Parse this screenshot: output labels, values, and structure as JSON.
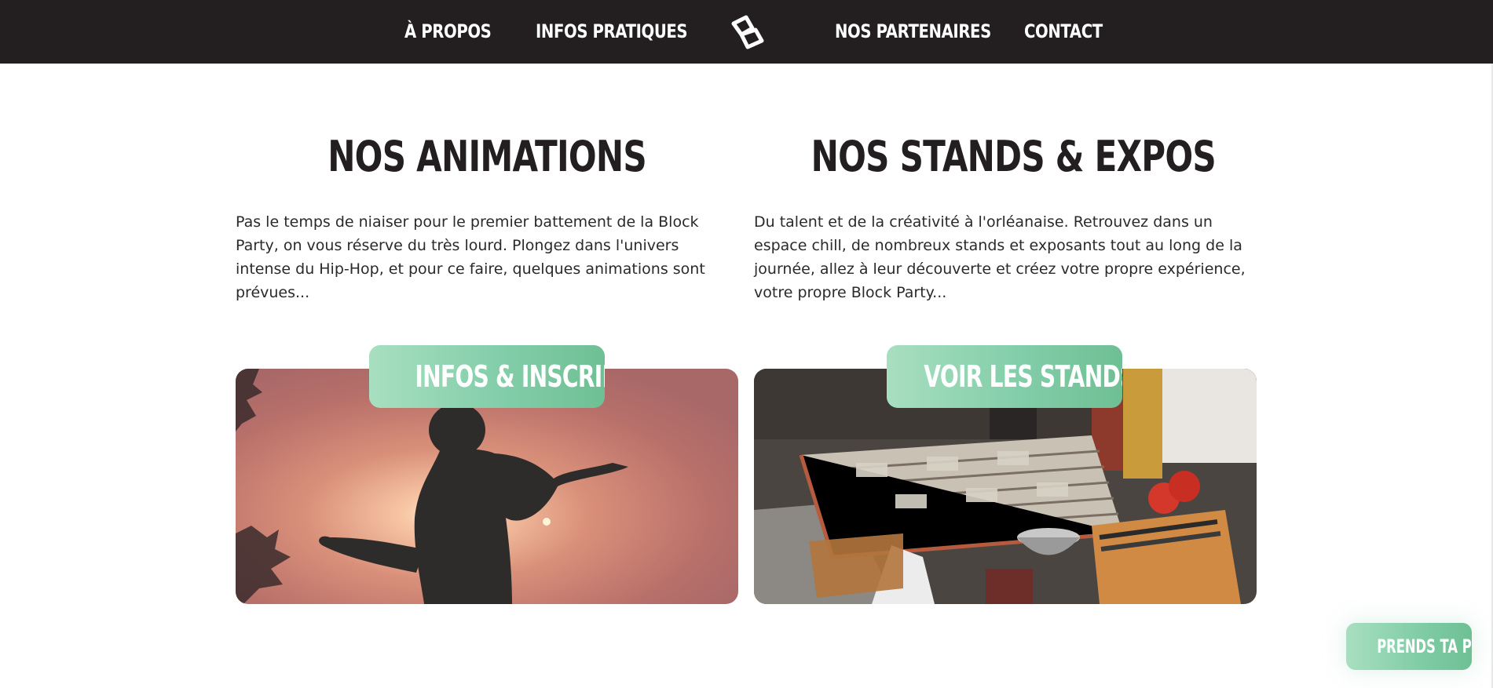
{
  "nav": {
    "items": [
      {
        "label": "À PROPOS"
      },
      {
        "label": "INFOS PRATIQUES"
      },
      {
        "label": "NOS PARTENAIRES"
      },
      {
        "label": "CONTACT"
      }
    ],
    "logo_icon": "block-party-logo-icon"
  },
  "sections": [
    {
      "title": "NOS ANIMATIONS",
      "text": "Pas le temps de niaiser pour le premier battement de la Block Party, on vous réserve du très lourd. Plongez dans l'univers intense du Hip-Hop, et pour ce faire, quelques animations sont prévues...",
      "button": "INFOS & INSCRIPTION",
      "image_icon": "dancer-silhouette-photo"
    },
    {
      "title": "NOS STANDS & EXPOS",
      "text": "Du talent et de la créativité à l'orléanaise. Retrouvez dans un espace chill, de nombreux stands et exposants tout au long de la journée, allez à leur découverte et créez votre propre expérience, votre propre Block Party...",
      "button": "VOIR LES STANDS",
      "image_icon": "record-stand-photo"
    }
  ],
  "cta": {
    "label": "PRENDS TA PLACE"
  },
  "colors": {
    "nav_bg": "#231f20",
    "accent_green": "#83ceaa",
    "heading": "#231f20"
  }
}
